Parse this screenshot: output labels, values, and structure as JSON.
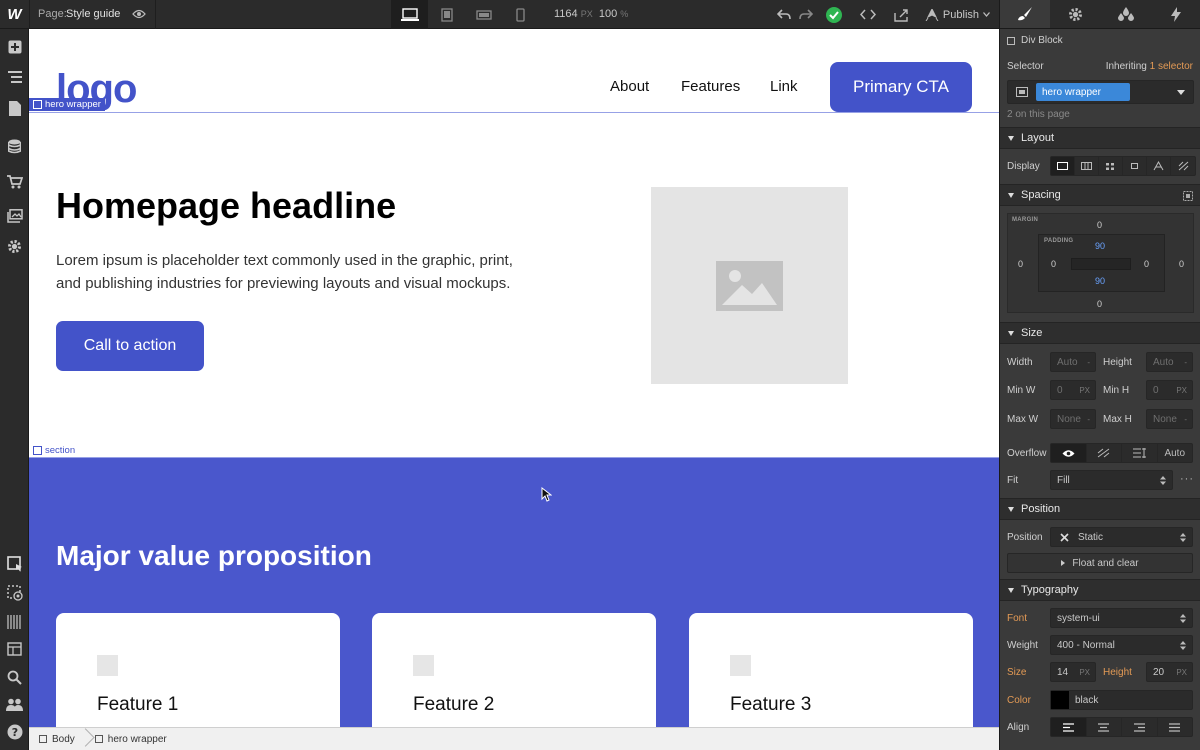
{
  "topbar": {
    "logo": "W",
    "page_label": "Page:",
    "page_name": "Style guide",
    "width_value": "1164",
    "width_unit": "PX",
    "zoom_value": "100",
    "zoom_unit": "%",
    "publish_label": "Publish"
  },
  "canvas": {
    "nav": {
      "brand": "logo",
      "links": [
        "About",
        "Features",
        "Link"
      ],
      "cta_label": "Primary CTA"
    },
    "hero_wrapper_label": "hero wrapper",
    "section_label": "section",
    "hero": {
      "headline": "Homepage headline",
      "paragraph": "Lorem ipsum is placeholder text commonly used in the graphic, print, and publishing industries for previewing layouts and visual mockups.",
      "button_label": "Call to action"
    },
    "value_section": {
      "title": "Major value proposition",
      "cards": [
        {
          "title": "Feature 1"
        },
        {
          "title": "Feature 2"
        },
        {
          "title": "Feature 3"
        }
      ]
    }
  },
  "breadcrumbs": [
    "Body",
    "hero wrapper"
  ],
  "panel": {
    "element_type": "Div Block",
    "selector_label": "Selector",
    "inheriting_label": "Inheriting",
    "inheriting_count": "1",
    "inheriting_suffix": "selector",
    "selector_tag": "hero wrapper",
    "on_page": "2 on this page",
    "sections": {
      "layout": "Layout",
      "spacing": "Spacing",
      "size": "Size",
      "position": "Position",
      "typography": "Typography"
    },
    "display_label": "Display",
    "spacing": {
      "margin_caption": "MARGIN",
      "padding_caption": "PADDING",
      "margin_top": "0",
      "margin_left": "0",
      "margin_right": "0",
      "margin_bottom": "0",
      "padding_top": "90",
      "padding_left": "0",
      "padding_right": "0",
      "padding_bottom": "90"
    },
    "size": {
      "width_label": "Width",
      "width_value": "Auto",
      "height_label": "Height",
      "height_value": "Auto",
      "minw_label": "Min W",
      "minw_value": "0",
      "minw_unit": "PX",
      "minh_label": "Min H",
      "minh_value": "0",
      "minh_unit": "PX",
      "maxw_label": "Max W",
      "maxw_value": "None",
      "maxh_label": "Max H",
      "maxh_value": "None",
      "overflow_label": "Overflow",
      "overflow_auto": "Auto",
      "fit_label": "Fit",
      "fit_value": "Fill"
    },
    "position": {
      "label": "Position",
      "value": "Static",
      "float_label": "Float and clear"
    },
    "typography": {
      "font_label": "Font",
      "font_value": "system-ui",
      "weight_label": "Weight",
      "weight_value": "400 - Normal",
      "size_label": "Size",
      "size_value": "14",
      "size_unit": "PX",
      "height_label": "Height",
      "height_value": "20",
      "height_unit": "PX",
      "color_label": "Color",
      "color_value": "black",
      "align_label": "Align"
    }
  },
  "colors": {
    "brand": "#4353c9",
    "section_bg": "#4a57cc",
    "selector_tag": "#3b88d9",
    "status_ok": "#2fb552"
  },
  "icons": [
    "eye-icon",
    "desktop-icon",
    "tablet-icon",
    "landscape-phone-icon",
    "phone-icon",
    "undo-icon",
    "redo-icon",
    "check-icon",
    "code-icon",
    "export-icon",
    "publish-icon",
    "brush-icon",
    "gear-icon",
    "drops-icon",
    "bolt-icon"
  ]
}
